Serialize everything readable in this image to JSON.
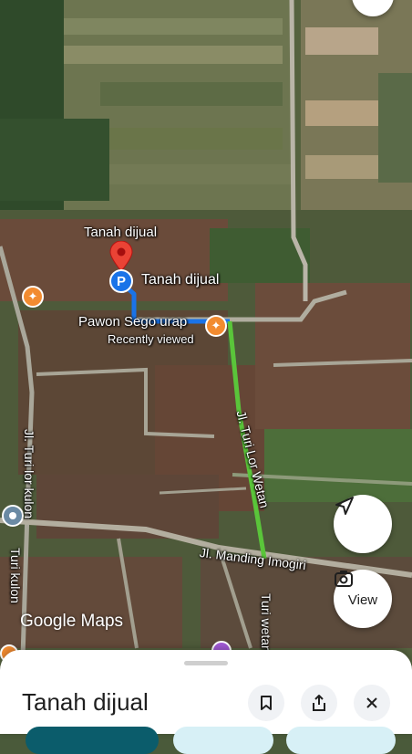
{
  "map": {
    "place_label_top": "Tanah dijual",
    "place_label_pin": "Tanah dijual",
    "poi_name": "Pawon Sego urap",
    "poi_sub": "Recently viewed",
    "roads": {
      "turi_lor_kulon": "Jl. Turi lor kulon",
      "turi_lor_wetan": "Jl. Turi Lor Wetan",
      "mandingan": "Jl. Manding Imogiri",
      "turi_kulon": "Turi kulon",
      "turi_wetan": "Turi wetan"
    },
    "watermark": "Google Maps",
    "route_colors": {
      "walk": "#1a73e8",
      "drive": "#5ac53a"
    },
    "pin_color": "#ea4335",
    "poi_color": "#f28b30"
  },
  "controls": {
    "locate_icon": "navigation-arrow-icon",
    "view_label": "View",
    "view_icon": "camera-icon"
  },
  "sheet": {
    "title": "Tanah dijual",
    "actions": [
      "bookmark-icon",
      "share-icon",
      "close-icon"
    ]
  }
}
